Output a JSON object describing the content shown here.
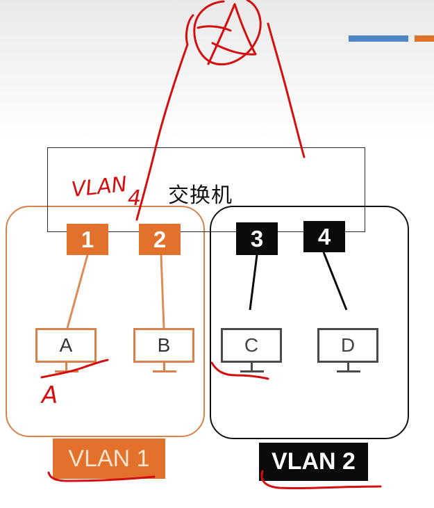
{
  "colors": {
    "vlan1_orange": "#e2712b",
    "vlan1_border": "#d9814a",
    "vlan1_line": "#dd8b57",
    "vlan2_black": "#0b0b0b",
    "monitor_gray": "#4a4a4a",
    "annotation_red": "#d40e0e",
    "deco_blue": "#4e86c6",
    "deco_orange": "#e0712b"
  },
  "switch": {
    "label": "交换机"
  },
  "ports": [
    {
      "label": "1",
      "vlan": 1
    },
    {
      "label": "2",
      "vlan": 1
    },
    {
      "label": "3",
      "vlan": 2
    },
    {
      "label": "4",
      "vlan": 2
    }
  ],
  "hosts": [
    {
      "label": "A",
      "vlan": 1
    },
    {
      "label": "B",
      "vlan": 1
    },
    {
      "label": "C",
      "vlan": 2
    },
    {
      "label": "D",
      "vlan": 2
    }
  ],
  "vlans": [
    {
      "label": "VLAN 1"
    },
    {
      "label": "VLAN 2"
    }
  ],
  "annotations": {
    "handwritten_vlan": "VLAN",
    "handwritten_number": "4",
    "handwritten_a": "A"
  }
}
